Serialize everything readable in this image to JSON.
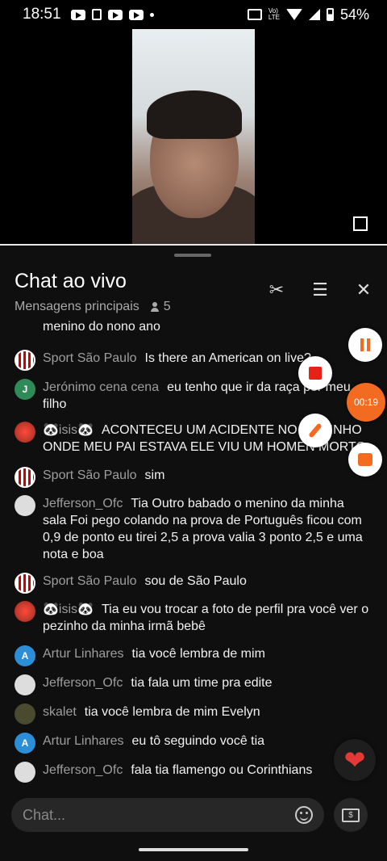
{
  "status_bar": {
    "time": "18:51",
    "battery": "54%",
    "volte_line1": "Vo)",
    "volte_line2": "LTE"
  },
  "video": {
    "label": "live-video"
  },
  "chat": {
    "title": "Chat ao vivo",
    "subtitle": "Mensagens principais",
    "viewer_count": "5",
    "input_placeholder": "Chat...",
    "timer": "00:19"
  },
  "messages": [
    {
      "author": "",
      "text": "menino do nono ano",
      "avatar": "isis"
    },
    {
      "author": "Sport São Paulo",
      "text": "Is there an American on live?",
      "avatar": "sp"
    },
    {
      "author": "Jerónimo cena cena",
      "text": "eu tenho que ir da raça por meu filho",
      "avatar": "j",
      "initial": "J"
    },
    {
      "author": "🐼isis🐼",
      "text": "ACONTECEU UM ACIDENTE NO CAMINHO ONDE MEU PAI ESTAVA ELE VIU UM HOMEN MORTO",
      "avatar": "isis"
    },
    {
      "author": "Sport São Paulo",
      "text": "sim",
      "avatar": "sp"
    },
    {
      "author": "Jefferson_Ofc",
      "text": "Tia Outro babado o menino da minha sala Foi pego colando na prova de Português ficou com 0,9 de ponto eu tirei 2,5 a prova valia 3 ponto 2,5 e uma nota e boa",
      "avatar": "jeff"
    },
    {
      "author": "Sport São Paulo",
      "text": "sou de São Paulo",
      "avatar": "sp"
    },
    {
      "author": "🐼isis🐼",
      "text": "Tia eu vou trocar a foto de perfil pra você ver o pezinho da minha irmã bebê",
      "avatar": "isis"
    },
    {
      "author": "Artur Linhares",
      "text": "tia você lembra de mim",
      "avatar": "a",
      "initial": "A"
    },
    {
      "author": "Jefferson_Ofc",
      "text": "tia fala um time pra edite",
      "avatar": "jeff"
    },
    {
      "author": "skalet",
      "text": "tia você lembra de mim Evelyn",
      "avatar": "sk"
    },
    {
      "author": "Artur Linhares",
      "text": "eu tô seguindo você tia",
      "avatar": "a",
      "initial": "A"
    },
    {
      "author": "Jefferson_Ofc",
      "text": "fala tia flamengo ou Corinthians",
      "avatar": "jeff"
    }
  ],
  "colors": {
    "accent": "#f26b21",
    "record_red": "#e62117",
    "heart": "#e53935",
    "panel_bg": "#0f0f0f"
  },
  "icons": [
    "scissors-icon",
    "tune-icon",
    "close-icon",
    "emoji-icon",
    "money-icon",
    "heart-icon",
    "pause-icon",
    "stop-icon",
    "brush-icon",
    "toolbox-icon"
  ]
}
